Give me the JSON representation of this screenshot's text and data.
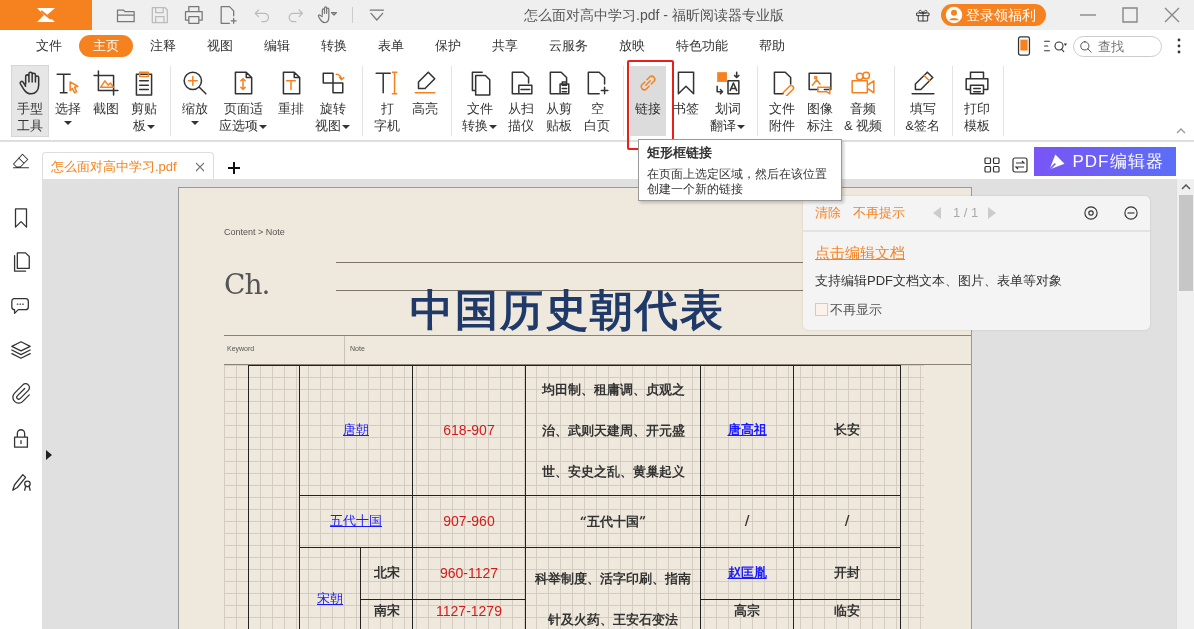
{
  "title_bar": {
    "title": "怎么面对高中学习.pdf - 福昕阅读器专业版",
    "login_button": "登录领福利"
  },
  "quick_tools": [
    {
      "kind": "open",
      "disabled": false
    },
    {
      "kind": "save",
      "disabled": true
    },
    {
      "kind": "print",
      "disabled": false
    },
    {
      "kind": "new",
      "disabled": false
    },
    {
      "kind": "undo",
      "disabled": true
    },
    {
      "kind": "redo",
      "disabled": true
    },
    {
      "kind": "hand",
      "disabled": false
    },
    {
      "kind": "customize",
      "disabled": false
    }
  ],
  "menu_tabs": [
    {
      "label": "文件",
      "selected": false
    },
    {
      "label": "主页",
      "selected": true
    },
    {
      "label": "注释",
      "selected": false
    },
    {
      "label": "视图",
      "selected": false
    },
    {
      "label": "编辑",
      "selected": false
    },
    {
      "label": "转换",
      "selected": false
    },
    {
      "label": "表单",
      "selected": false
    },
    {
      "label": "保护",
      "selected": false
    },
    {
      "label": "共享",
      "selected": false
    },
    {
      "label": "云服务",
      "selected": false
    },
    {
      "label": "放映",
      "selected": false
    },
    {
      "label": "特色功能",
      "selected": false
    },
    {
      "label": "帮助",
      "selected": false
    }
  ],
  "search": {
    "placeholder": "查找"
  },
  "ribbon": [
    {
      "tools": [
        {
          "kind": "hand",
          "lines": [
            "手型",
            "工具"
          ],
          "dropdown": false,
          "selected": true,
          "hovered": false
        },
        {
          "kind": "select",
          "lines": [
            "选择"
          ],
          "dropdown": true,
          "selected": false,
          "hovered": false
        },
        {
          "kind": "snapshot",
          "lines": [
            "截图"
          ],
          "dropdown": false,
          "selected": false,
          "hovered": false
        },
        {
          "kind": "clipboard",
          "lines": [
            "剪贴",
            "板"
          ],
          "dropdown": true,
          "selected": false,
          "hovered": false
        }
      ]
    },
    {
      "tools": [
        {
          "kind": "zoom",
          "lines": [
            "缩放"
          ],
          "dropdown": true,
          "selected": false,
          "hovered": false
        },
        {
          "kind": "fit",
          "lines": [
            "页面适",
            "应选项"
          ],
          "dropdown": true,
          "selected": false,
          "hovered": false
        },
        {
          "kind": "reflow",
          "lines": [
            "重排"
          ],
          "dropdown": false,
          "selected": false,
          "hovered": false
        },
        {
          "kind": "rotate",
          "lines": [
            "旋转",
            "视图"
          ],
          "dropdown": true,
          "selected": false,
          "hovered": false
        }
      ]
    },
    {
      "tools": [
        {
          "kind": "typewriter",
          "lines": [
            "打",
            "字机"
          ],
          "dropdown": false,
          "selected": false,
          "hovered": false
        },
        {
          "kind": "highlight",
          "lines": [
            "高亮"
          ],
          "dropdown": false,
          "selected": false,
          "hovered": false
        }
      ]
    },
    {
      "tools": [
        {
          "kind": "convert",
          "lines": [
            "文件",
            "转换"
          ],
          "dropdown": true,
          "selected": false,
          "hovered": false
        },
        {
          "kind": "scan",
          "lines": [
            "从扫",
            "描仪"
          ],
          "dropdown": false,
          "selected": false,
          "hovered": false
        },
        {
          "kind": "fromclip",
          "lines": [
            "从剪",
            "贴板"
          ],
          "dropdown": false,
          "selected": false,
          "hovered": false
        },
        {
          "kind": "blank",
          "lines": [
            "空",
            "白页"
          ],
          "dropdown": false,
          "selected": false,
          "hovered": false
        }
      ]
    },
    {
      "tools": [
        {
          "kind": "link",
          "lines": [
            "链接"
          ],
          "dropdown": false,
          "selected": false,
          "hovered": true,
          "framed": true,
          "tooltip": {
            "title": "矩形框链接",
            "text": "在页面上选定区域，然后在该位置创建一个新的链接"
          }
        },
        {
          "kind": "bookmark",
          "lines": [
            "书签"
          ],
          "dropdown": false,
          "selected": false,
          "hovered": false
        },
        {
          "kind": "translate",
          "lines": [
            "划词",
            "翻译"
          ],
          "dropdown": true,
          "selected": false,
          "hovered": false
        }
      ]
    },
    {
      "tools": [
        {
          "kind": "attach",
          "lines": [
            "文件",
            "附件"
          ],
          "dropdown": false,
          "selected": false,
          "hovered": false
        },
        {
          "kind": "image",
          "lines": [
            "图像",
            "标注"
          ],
          "dropdown": false,
          "selected": false,
          "hovered": false
        },
        {
          "kind": "media",
          "lines": [
            "音频",
            "& 视频"
          ],
          "dropdown": false,
          "selected": false,
          "hovered": false
        }
      ]
    },
    {
      "tools": [
        {
          "kind": "fill",
          "lines": [
            "填写",
            "&签名"
          ],
          "dropdown": false,
          "selected": false,
          "hovered": false
        }
      ]
    },
    {
      "tools": [
        {
          "kind": "printtpl",
          "lines": [
            "打印",
            "模板"
          ],
          "dropdown": false,
          "selected": false,
          "hovered": false
        }
      ]
    }
  ],
  "doc_tabs": [
    {
      "label": "怎么面对高中学习.pdf",
      "selected": true
    }
  ],
  "editor_banner": "PDF编辑器",
  "sidebar": [
    {
      "kind": "bookmark"
    },
    {
      "kind": "pages"
    },
    {
      "kind": "comments"
    },
    {
      "kind": "layers"
    },
    {
      "kind": "attachments"
    },
    {
      "kind": "security"
    },
    {
      "kind": "signature"
    }
  ],
  "page": {
    "breadcrumb": "Content > Note",
    "chapter": "Ch.",
    "title": "中国历史朝代表",
    "keyword_label": "Keyword",
    "note_label": "Note",
    "rows": [
      {
        "dynasty": "唐朝",
        "years": "618-907",
        "events": "均田制、租庸调、贞观之治、武则天建周、开元盛世、安史之乱、黄巢起义",
        "founder": "唐高祖",
        "founder_link": true,
        "capital": "长安"
      },
      {
        "dynasty": "五代十国",
        "years": "907-960",
        "events": "“五代十国”",
        "founder": "/",
        "founder_link": false,
        "capital": "/"
      },
      {
        "dynasty": "宋朝",
        "events": "科举制度、活字印刷、指南针及火药、王安石变法",
        "periods": [
          {
            "name": "北宋",
            "years": "960-1127",
            "founder": "赵匡胤",
            "founder_link": true,
            "capital": "开封"
          },
          {
            "name": "南宋",
            "years": "1127-1279",
            "founder": "高宗",
            "founder_link": false,
            "capital": "临安"
          }
        ]
      }
    ]
  },
  "notice": {
    "actions": [
      "清除",
      "不再提示"
    ],
    "pager": "1 / 1",
    "link": "点击编辑文档",
    "description": "支持编辑PDF文档文本、图片、表单等对象",
    "checkbox": {
      "label": "不再显示",
      "checked": false
    }
  }
}
